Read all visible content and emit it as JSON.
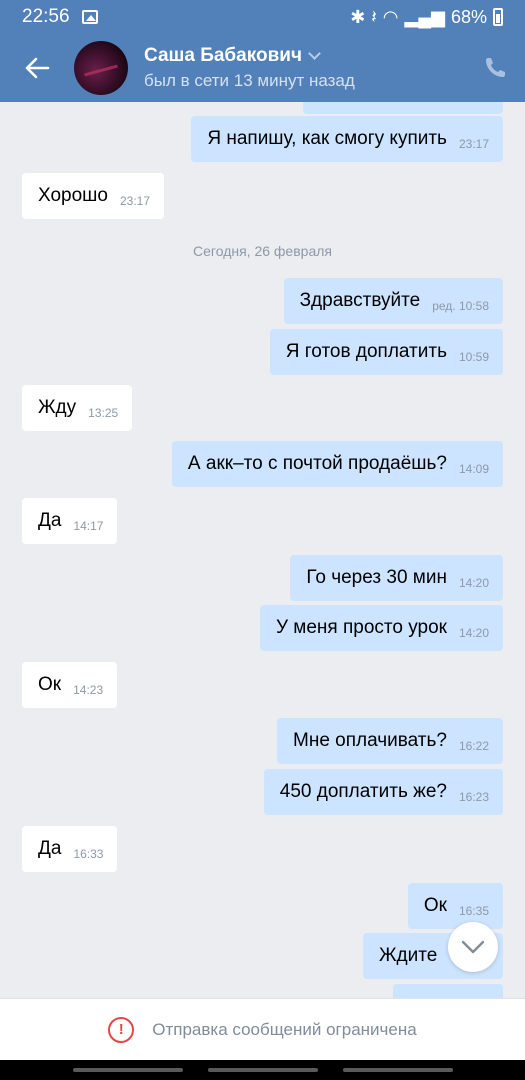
{
  "status_bar": {
    "time": "22:56",
    "battery": "68%",
    "icons": [
      "image-icon",
      "bluetooth-icon",
      "mute-icon",
      "wifi-icon",
      "signal-icon",
      "battery-icon"
    ]
  },
  "header": {
    "contact_name": "Саша Бабакович",
    "contact_status": "был в сети 13 минут назад"
  },
  "date_separator": "Сегодня, 26 февраля",
  "messages": [
    {
      "dir": "out",
      "text": "Я напишу, как смогу купить",
      "time": "23:17"
    },
    {
      "dir": "in",
      "text": "Хорошо",
      "time": "23:17"
    },
    {
      "dir": "out",
      "text": "Здравствуйте",
      "time": "ред. 10:58"
    },
    {
      "dir": "out",
      "text": "Я готов доплатить",
      "time": "10:59"
    },
    {
      "dir": "in",
      "text": "Жду",
      "time": "13:25"
    },
    {
      "dir": "out",
      "text": "А акк–то с почтой продаёшь?",
      "time": "14:09"
    },
    {
      "dir": "in",
      "text": "Да",
      "time": "14:17"
    },
    {
      "dir": "out",
      "text": "Го через 30 мин",
      "time": "14:20"
    },
    {
      "dir": "out",
      "text": "У меня просто урок",
      "time": "14:20"
    },
    {
      "dir": "in",
      "text": "Ок",
      "time": "14:23"
    },
    {
      "dir": "out",
      "text": "Мне оплачивать?",
      "time": "16:22"
    },
    {
      "dir": "out",
      "text": "450 доплатить же?",
      "time": "16:23"
    },
    {
      "dir": "in",
      "text": "Да",
      "time": "16:33"
    },
    {
      "dir": "out",
      "text": "Ок",
      "time": "16:35"
    },
    {
      "dir": "out",
      "text": "Ждите",
      "time": ""
    }
  ],
  "restricted_notice": "Отправка сообщений ограничена",
  "colors": {
    "header": "#5181b8",
    "incoming_bubble": "#ffffff",
    "outgoing_bubble": "#cce4ff",
    "background": "#ebedf0",
    "warning": "#e64646"
  }
}
